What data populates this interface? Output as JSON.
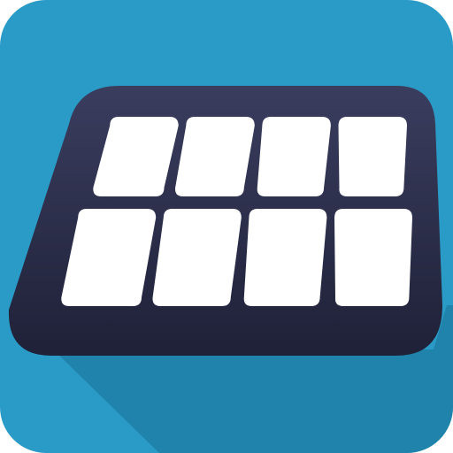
{
  "icon": {
    "name": "solar-panel-icon",
    "colors": {
      "background": "#2A9AC6",
      "long_shadow": "#1F7FA6",
      "panel_frame_top": "#3A3D5E",
      "panel_frame_bottom": "#1F2138",
      "cell": "#FFFFFF"
    },
    "grid": {
      "rows": 2,
      "columns": 4
    }
  }
}
